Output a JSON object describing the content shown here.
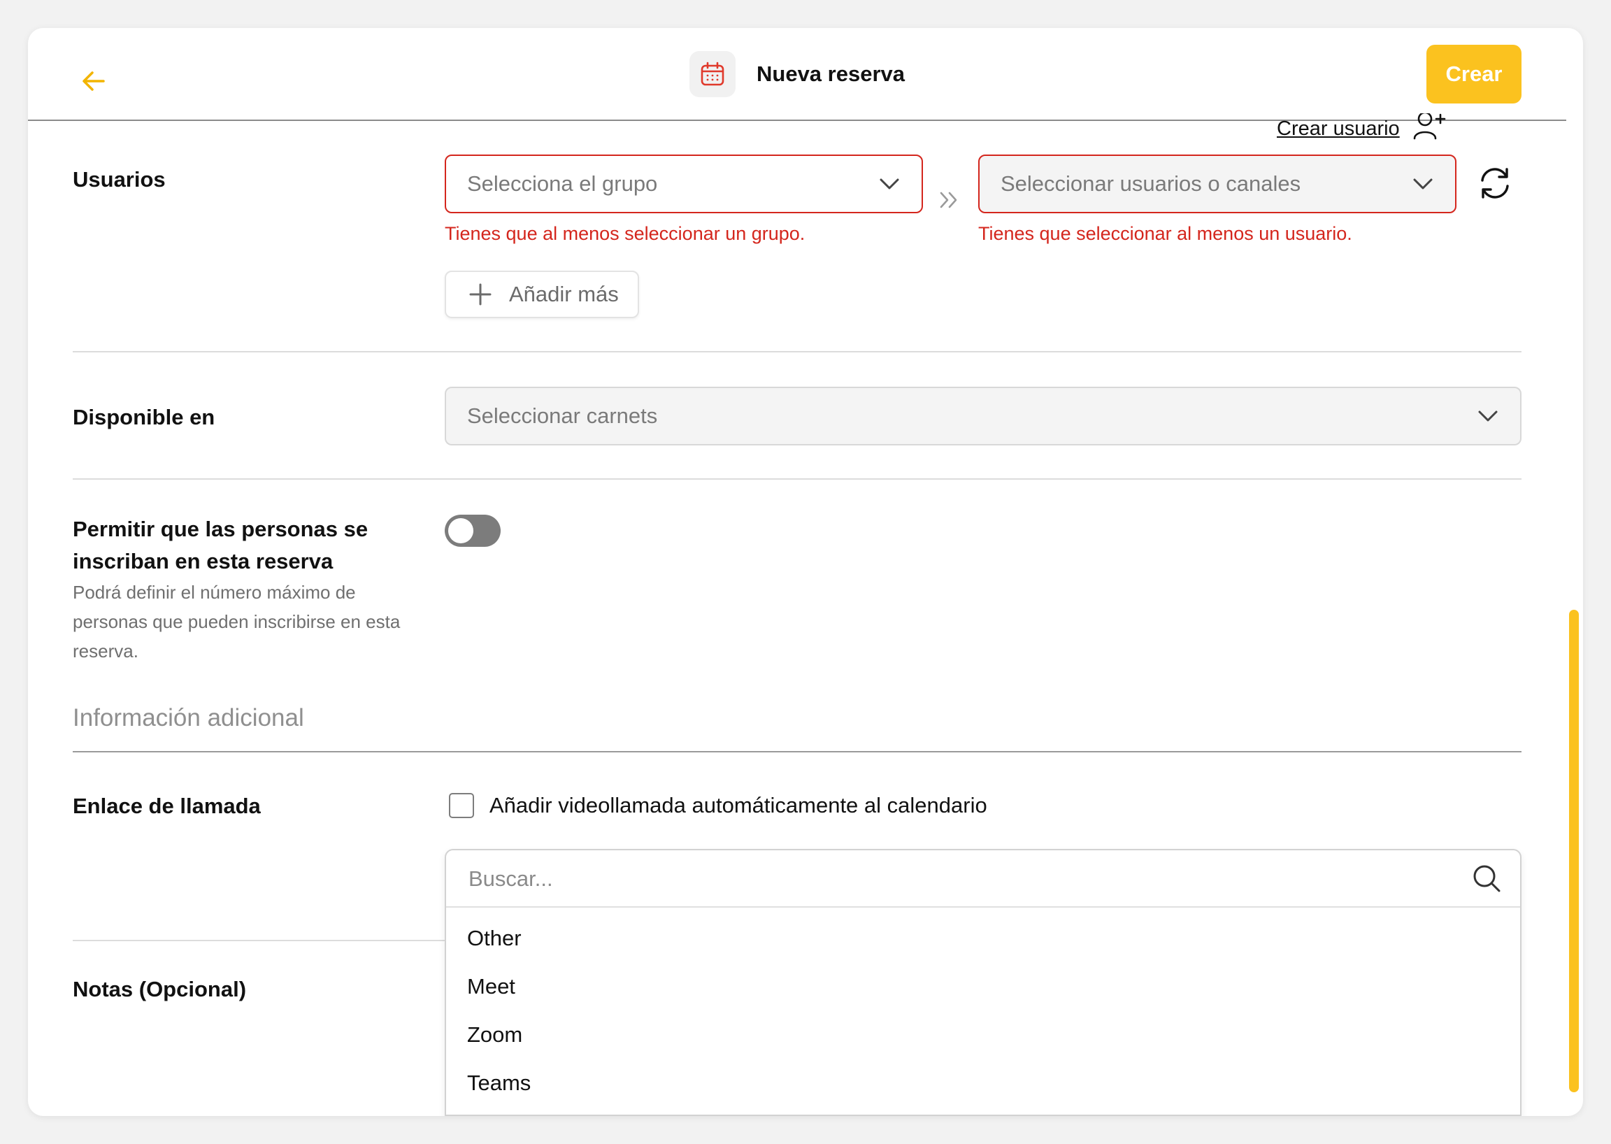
{
  "header": {
    "title": "Nueva reserva",
    "create_label": "Crear",
    "create_user_label": "Crear usuario"
  },
  "usuarios": {
    "label": "Usuarios",
    "group_select": {
      "placeholder": "Selecciona el grupo",
      "error": "Tienes que al menos seleccionar un grupo."
    },
    "users_select": {
      "placeholder": "Seleccionar usuarios o canales",
      "error": "Tienes que seleccionar al menos un usuario."
    },
    "add_more_label": "Añadir más"
  },
  "disponible": {
    "label": "Disponible en",
    "placeholder": "Seleccionar carnets"
  },
  "inscripcion": {
    "label_line1": "Permitir que las personas se",
    "label_line2": "inscriban en esta reserva",
    "desc_line1": "Podrá definir el número máximo de",
    "desc_line2": "personas que pueden inscribirse en esta",
    "desc_line3": "reserva.",
    "toggle_on": false
  },
  "info_adicional": {
    "title": "Información adicional"
  },
  "enlace": {
    "label": "Enlace de llamada",
    "checkbox_label": "Añadir videollamada automáticamente al calendario",
    "checked": false,
    "search_placeholder": "Buscar...",
    "options": [
      "Other",
      "Meet",
      "Zoom",
      "Teams"
    ]
  },
  "notas": {
    "label": "Notas (Opcional)"
  },
  "colors": {
    "accent": "#fbc21f",
    "error": "#d4261d",
    "calendar_icon": "#e0392b"
  }
}
